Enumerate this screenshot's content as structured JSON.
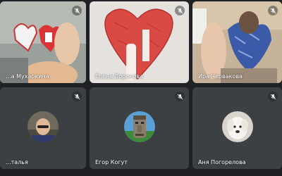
{
  "participants": [
    {
      "name": "...а Мухаркина",
      "muted": true,
      "has_video": true
    },
    {
      "name": "Елена Воронова",
      "muted": true,
      "has_video": true
    },
    {
      "name": "Ира Черваковa",
      "muted": true,
      "has_video": true
    },
    {
      "name": "...талья",
      "muted": true,
      "has_video": false
    },
    {
      "name": "Егор Когут",
      "muted": true,
      "has_video": false
    },
    {
      "name": "Аня Погорелова",
      "muted": true,
      "has_video": false
    }
  ],
  "colors": {
    "background": "#202124",
    "tile": "#3c4043",
    "text": "#ffffff"
  },
  "icons": {
    "mute": "mic-off-icon"
  }
}
